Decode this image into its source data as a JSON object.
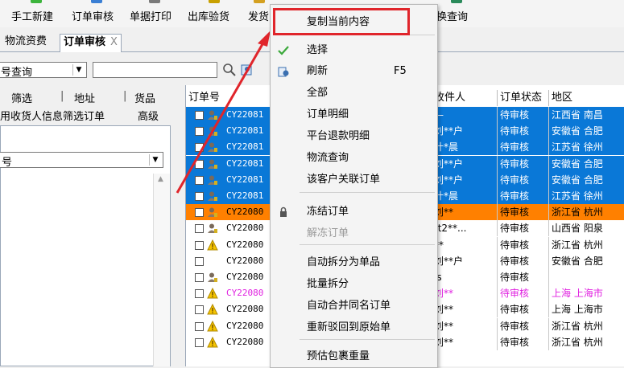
{
  "toolbar": {
    "buttons": [
      "手工新建",
      "订单审核",
      "单据打印",
      "出库验货",
      "发货",
      "换查询"
    ]
  },
  "tabs": [
    {
      "label": "物流资费",
      "active": false
    },
    {
      "label": "订单审核",
      "active": true,
      "close": "X"
    }
  ],
  "query": {
    "field_select": "号查询",
    "search_value": ""
  },
  "left_panel": {
    "tabs": [
      "筛选",
      "地址",
      "货品"
    ],
    "hint": "用收货人信息筛选订单",
    "advanced": "高级",
    "field_select": "号"
  },
  "grid": {
    "columns": [
      "订单号",
      "收件人",
      "订单状态",
      "地区"
    ],
    "rows": [
      {
        "code": "CY22081",
        "recipient": "—",
        "status": "待审核",
        "region": "江西省 南昌",
        "style": "selected",
        "icon": "person-icon"
      },
      {
        "code": "CY22081",
        "recipient": "刘**户",
        "status": "待审核",
        "region": "安徽省 合肥",
        "style": "selected",
        "icon": "person-icon"
      },
      {
        "code": "CY22081",
        "recipient": "计*晨",
        "status": "待审核",
        "region": "江苏省 徐州",
        "style": "selected",
        "icon": "person-icon"
      },
      {
        "code": "CY22081",
        "recipient": "刘**户",
        "status": "待审核",
        "region": "安徽省 合肥",
        "style": "selected",
        "icon": "person-icon"
      },
      {
        "code": "CY22081",
        "recipient": "刘**户",
        "status": "待审核",
        "region": "安徽省 合肥",
        "style": "selected",
        "icon": "person-icon"
      },
      {
        "code": "CY22081",
        "recipient": "计*晨",
        "status": "待审核",
        "region": "江苏省 徐州",
        "style": "selected",
        "icon": "person-icon"
      },
      {
        "code": "CY22080",
        "recipient": "刘**",
        "status": "待审核",
        "region": "浙江省 杭州",
        "style": "orange",
        "icon": "person-icon"
      },
      {
        "code": "CY22080",
        "recipient": "tt2**...",
        "status": "待审核",
        "region": "山西省 阳泉",
        "style": "normal",
        "icon": "person-icon"
      },
      {
        "code": "CY22080",
        "recipient": "**",
        "status": "待审核",
        "region": "浙江省 杭州",
        "style": "normal",
        "icon": "warning-icon"
      },
      {
        "code": "CY22080",
        "recipient": "刘**户",
        "status": "待审核",
        "region": "安徽省 合肥",
        "style": "normal",
        "icon": "none"
      },
      {
        "code": "CY22080",
        "recipient": "js",
        "status": "待审核",
        "region": "",
        "style": "normal",
        "icon": "person-icon"
      },
      {
        "code": "CY22080",
        "recipient": "刘**",
        "status": "待审核",
        "region": "上海 上海市",
        "style": "magenta",
        "icon": "warning-icon"
      },
      {
        "code": "CY22080",
        "recipient": "刘**",
        "status": "待审核",
        "region": "上海 上海市",
        "style": "normal",
        "icon": "warning-icon"
      },
      {
        "code": "CY22080",
        "recipient": "刘**",
        "status": "待审核",
        "region": "浙江省 杭州",
        "style": "normal",
        "icon": "warning-icon"
      },
      {
        "code": "CY22080",
        "recipient": "刘**",
        "status": "待审核",
        "region": "浙江省 杭州",
        "style": "normal",
        "icon": "warning-icon"
      }
    ]
  },
  "context_menu": {
    "items": [
      {
        "label": "复制当前内容",
        "shortcut": "",
        "icon": "",
        "disabled": false
      },
      {
        "label": "选择",
        "shortcut": "",
        "icon": "check-icon",
        "disabled": false
      },
      {
        "label": "刷新",
        "shortcut": "F5",
        "icon": "refresh-icon",
        "disabled": false
      },
      {
        "label": "全部",
        "shortcut": "",
        "icon": "",
        "disabled": false
      },
      {
        "label": "订单明细",
        "shortcut": "",
        "icon": "",
        "disabled": false
      },
      {
        "label": "平台退款明细",
        "shortcut": "",
        "icon": "",
        "disabled": false
      },
      {
        "label": "物流查询",
        "shortcut": "",
        "icon": "",
        "disabled": false
      },
      {
        "label": "该客户关联订单",
        "shortcut": "",
        "icon": "",
        "disabled": false
      },
      {
        "label": "冻结订单",
        "shortcut": "",
        "icon": "lock-icon",
        "disabled": false
      },
      {
        "label": "解冻订单",
        "shortcut": "",
        "icon": "",
        "disabled": true
      },
      {
        "label": "自动拆分为单品",
        "shortcut": "",
        "icon": "",
        "disabled": false
      },
      {
        "label": "批量拆分",
        "shortcut": "",
        "icon": "",
        "disabled": false
      },
      {
        "label": "自动合并同名订单",
        "shortcut": "",
        "icon": "",
        "disabled": false
      },
      {
        "label": "重新驳回到原始单",
        "shortcut": "",
        "icon": "",
        "disabled": false
      },
      {
        "label": "预估包裹重量",
        "shortcut": "",
        "icon": "",
        "disabled": false
      }
    ]
  },
  "colors": {
    "selected_row": "#0a78d7",
    "orange_row": "#ff8000",
    "magenta_text": "#e020e0",
    "highlight_box": "#e0252b",
    "annotation_arrow": "#e0252b"
  }
}
